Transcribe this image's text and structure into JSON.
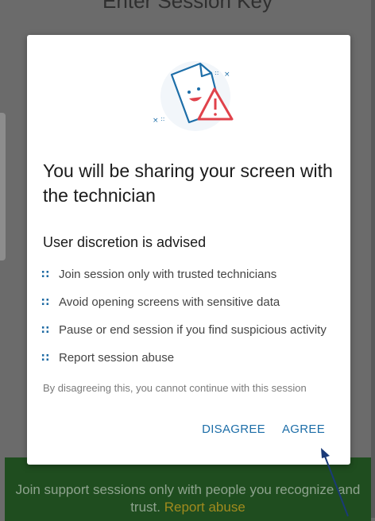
{
  "background": {
    "title": "Enter Session Key",
    "banner_text": "Join support sessions only with people you recognize and trust.",
    "banner_link": "Report abuse"
  },
  "dialog": {
    "title": "You will be sharing your screen with the technician",
    "subtitle": "User discretion is advised",
    "bullets": [
      "Join session only with trusted technicians",
      "Avoid opening screens with sensitive data",
      "Pause or end session if you find suspicious activity",
      "Report session abuse"
    ],
    "disclaimer": "By disagreeing this, you cannot continue with this session",
    "disagree_label": "DISAGREE",
    "agree_label": "AGREE"
  },
  "colors": {
    "accent": "#1d6ea8",
    "banner_bg": "#1f4d1f",
    "warning": "#e0424b"
  }
}
